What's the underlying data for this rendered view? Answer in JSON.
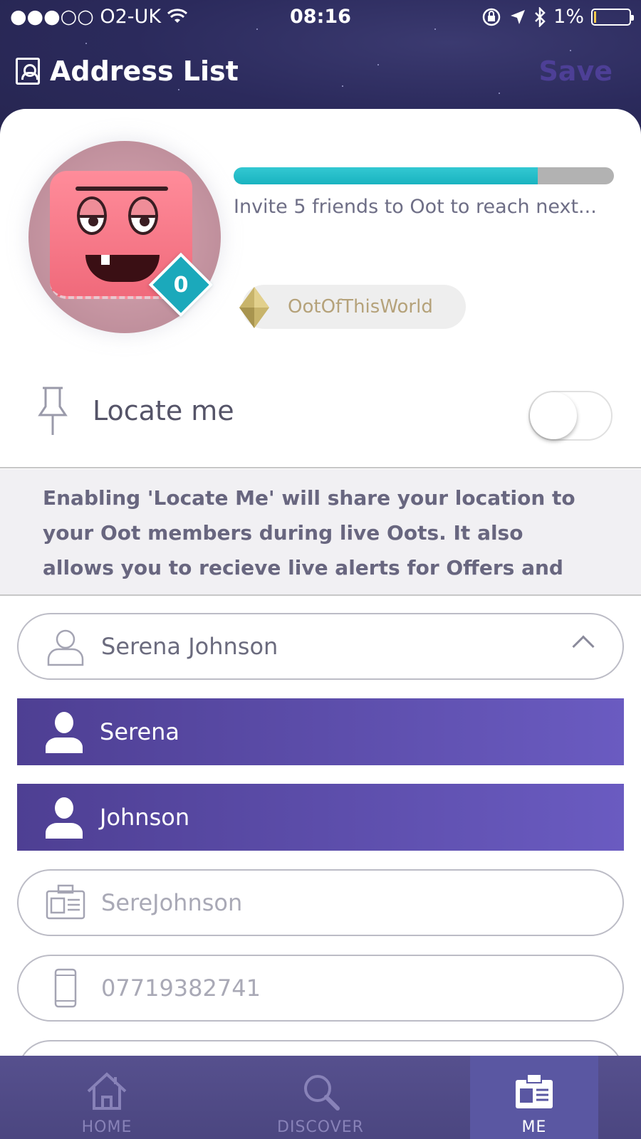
{
  "status_bar": {
    "carrier": "●●●○○ O2-UK",
    "time": "08:16",
    "battery": "1%"
  },
  "header": {
    "title": "Address List",
    "save_label": "Save"
  },
  "profile": {
    "level": "0",
    "progress_percent": 80,
    "invite_text": "Invite 5 friends to Oot to reach next...",
    "tier_name": "OotOfThisWorld"
  },
  "locate": {
    "label": "Locate me",
    "enabled": false,
    "info_text": "Enabling 'Locate Me' will share your location to your Oot members during live Oots. It also allows you to recieve live alerts for Offers and"
  },
  "form": {
    "full_name": "Serena Johnson",
    "first_name": "Serena",
    "last_name": "Johnson",
    "username_placeholder": "SereJohnson",
    "phone_placeholder": "07719382741"
  },
  "nav": {
    "items": [
      {
        "label": "HOME",
        "icon": "home-icon"
      },
      {
        "label": "DISCOVER",
        "icon": "search-icon"
      },
      {
        "label": "ME",
        "icon": "id-card-icon"
      }
    ],
    "active": "ME"
  },
  "colors": {
    "header_bg": "#2b2a5c",
    "accent_teal": "#1ba9bb",
    "purple": "#5a4ca8",
    "nav_bg": "#4e4985"
  }
}
